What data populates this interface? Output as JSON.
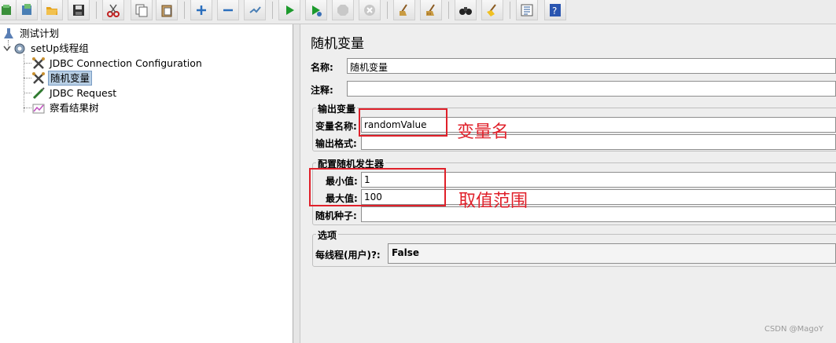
{
  "toolbar": {
    "buttons": [
      "open-test-plan-icon",
      "templates-icon",
      "open-icon",
      "save-icon",
      "cut-icon",
      "copy-icon",
      "paste-icon",
      "expand-icon",
      "collapse-icon",
      "toggle-icon",
      "start-icon",
      "start-no-pauses-icon",
      "stop-icon",
      "shutdown-icon",
      "clear-icon",
      "clear-all-icon",
      "search-icon",
      "reset-search-icon",
      "function-helper-icon",
      "help-icon"
    ]
  },
  "tree": {
    "items": [
      {
        "label": "测试计划"
      },
      {
        "label": "setUp线程组"
      },
      {
        "label": "JDBC Connection Configuration"
      },
      {
        "label": "随机变量"
      },
      {
        "label": "JDBC Request"
      },
      {
        "label": "察看结果树"
      }
    ]
  },
  "panel": {
    "title": "随机变量",
    "name_label": "名称:",
    "name_value": "随机变量",
    "comment_label": "注释:",
    "comment_value": "",
    "output_group": {
      "title": "输出变量",
      "varname_label": "变量名称:",
      "varname_value": "randomValue",
      "format_label": "输出格式:",
      "format_value": ""
    },
    "generator_group": {
      "title": "配置随机发生器",
      "min_label": "最小值:",
      "min_value": "1",
      "max_label": "最大值:",
      "max_value": "100",
      "seed_label": "随机种子:",
      "seed_value": ""
    },
    "options_group": {
      "title": "选项",
      "per_thread_label": "每线程(用户)?:",
      "per_thread_value": "False"
    }
  },
  "annotations": {
    "varname_note": "变量名",
    "range_note": "取值范围"
  },
  "watermark": "CSDN @MagoY",
  "colors": {
    "annotation": "#e0202a",
    "selection": "#b8cfe5"
  }
}
